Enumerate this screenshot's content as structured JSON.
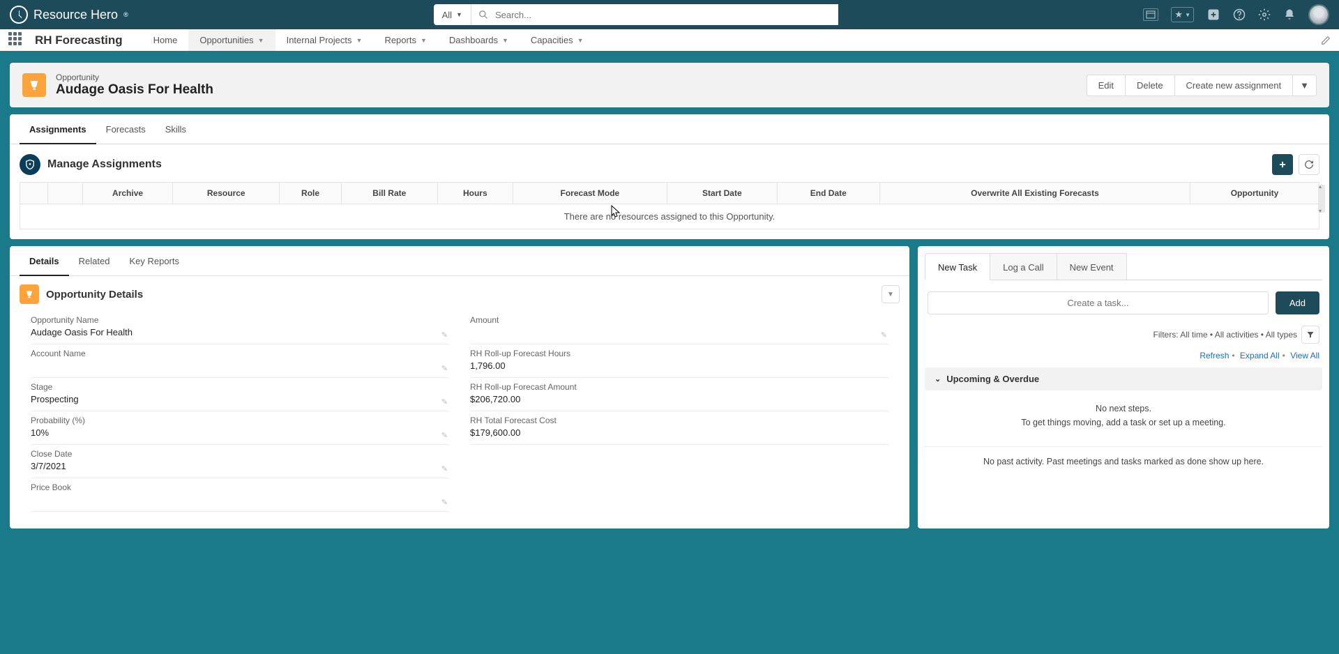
{
  "brand": {
    "name": "Resource Hero"
  },
  "search": {
    "scope": "All",
    "placeholder": "Search..."
  },
  "app": {
    "name": "RH Forecasting"
  },
  "nav": {
    "items": [
      {
        "label": "Home",
        "dropdown": false
      },
      {
        "label": "Opportunities",
        "dropdown": true,
        "active": true
      },
      {
        "label": "Internal Projects",
        "dropdown": true
      },
      {
        "label": "Reports",
        "dropdown": true
      },
      {
        "label": "Dashboards",
        "dropdown": true
      },
      {
        "label": "Capacities",
        "dropdown": true
      }
    ]
  },
  "record": {
    "subtitle": "Opportunity",
    "title": "Audage Oasis For Health",
    "actions": {
      "edit": "Edit",
      "delete": "Delete",
      "create": "Create new assignment"
    }
  },
  "assignTabs": {
    "t0": "Assignments",
    "t1": "Forecasts",
    "t2": "Skills"
  },
  "manage": {
    "title": "Manage Assignments"
  },
  "grid": {
    "cols": {
      "archive": "Archive",
      "resource": "Resource",
      "role": "Role",
      "billrate": "Bill Rate",
      "hours": "Hours",
      "mode": "Forecast Mode",
      "start": "Start Date",
      "end": "End Date",
      "overwrite": "Overwrite All Existing Forecasts",
      "opp": "Opportunity"
    },
    "empty": "There are no resources assigned to this Opportunity."
  },
  "detailTabs": {
    "t0": "Details",
    "t1": "Related",
    "t2": "Key Reports"
  },
  "detailSection": {
    "title": "Opportunity Details"
  },
  "fields": {
    "opp_name_label": "Opportunity Name",
    "opp_name_value": "Audage Oasis For Health",
    "account_label": "Account Name",
    "account_value": "",
    "stage_label": "Stage",
    "stage_value": "Prospecting",
    "prob_label": "Probability (%)",
    "prob_value": "10%",
    "close_label": "Close Date",
    "close_value": "3/7/2021",
    "pricebook_label": "Price Book",
    "pricebook_value": "",
    "amount_label": "Amount",
    "amount_value": "",
    "hours_label": "RH Roll-up Forecast Hours",
    "hours_value": "1,796.00",
    "famount_label": "RH Roll-up Forecast Amount",
    "famount_value": "$206,720.00",
    "cost_label": "RH Total Forecast Cost",
    "cost_value": "$179,600.00"
  },
  "activity": {
    "tabs": {
      "t0": "New Task",
      "t1": "Log a Call",
      "t2": "New Event"
    },
    "placeholder": "Create a task...",
    "add": "Add",
    "filters": "Filters: All time • All activities • All types",
    "links": {
      "refresh": "Refresh",
      "expand": "Expand All",
      "view": "View All"
    },
    "upcoming": "Upcoming & Overdue",
    "empty1": "No next steps.",
    "empty2": "To get things moving, add a task or set up a meeting.",
    "past": "No past activity. Past meetings and tasks marked as done show up here."
  }
}
